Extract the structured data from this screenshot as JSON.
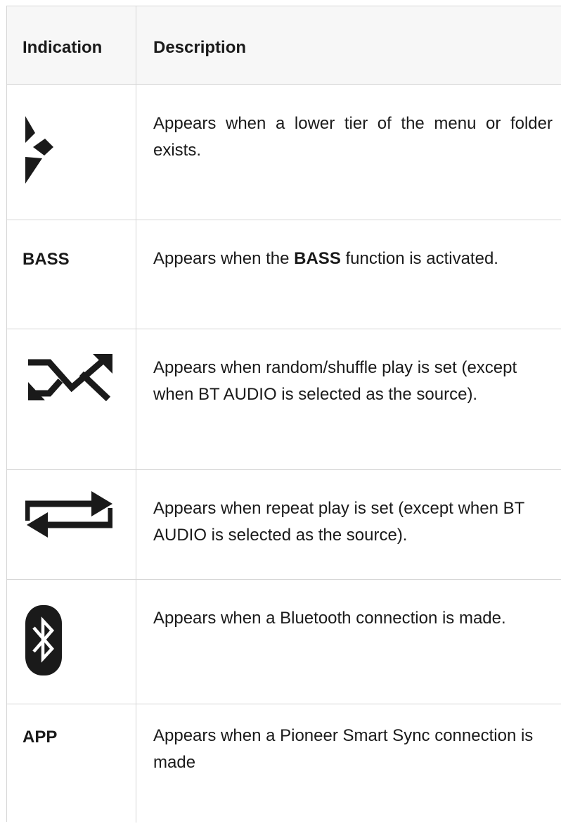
{
  "table": {
    "headers": {
      "indication": "Indication",
      "description": "Description"
    },
    "rows": [
      {
        "indication_icon": "menu-tier-arrow-icon",
        "description": "Appears when a lower tier of the menu or folder exists."
      },
      {
        "indication_text": "BASS",
        "description_pre": "Appears when the",
        "description_bold": "BASS",
        "description_post": "function is activated."
      },
      {
        "indication_icon": "shuffle-icon",
        "description": "Appears when random/shuffle play is set (except when BT AUDIO is selected as the source)."
      },
      {
        "indication_icon": "repeat-icon",
        "description": "Appears when repeat play is set (except when BT AUDIO is selected as the source)."
      },
      {
        "indication_icon": "bluetooth-icon",
        "description": "Appears when a Bluetooth connection is made."
      },
      {
        "indication_text": "APP",
        "description": "Appears when a Pioneer Smart Sync connection is made"
      }
    ]
  },
  "colors": {
    "border": "#d6d6d6",
    "header_bg": "#f7f7f7",
    "text": "#1a1a1a"
  }
}
